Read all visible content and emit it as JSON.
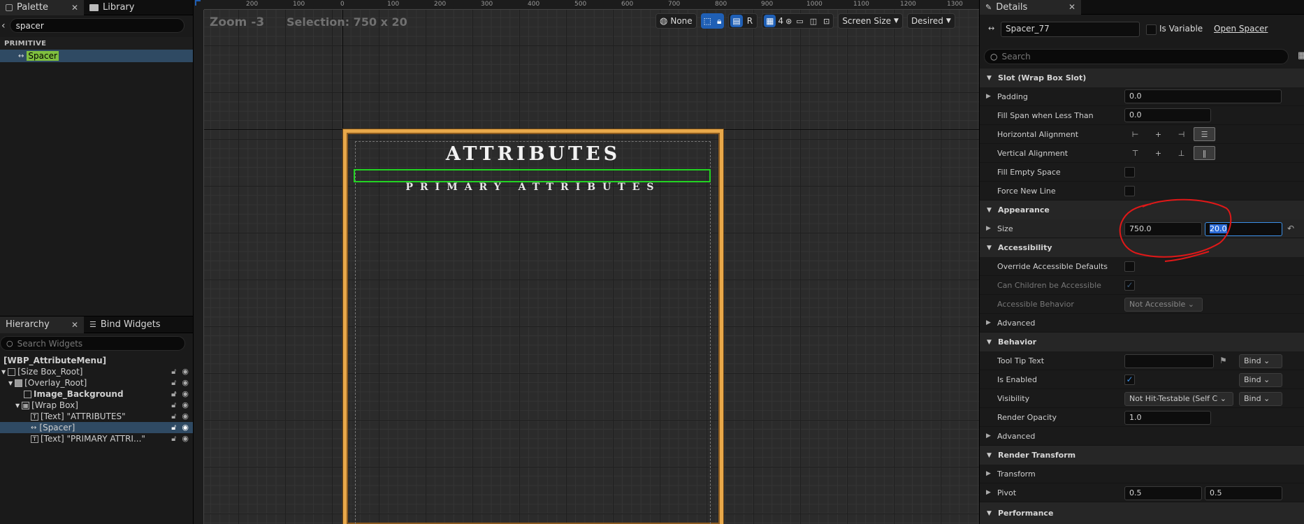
{
  "palette": {
    "tab_label": "Palette",
    "library_label": "Library",
    "search_value": "spacer",
    "category": "PRIMITIVE",
    "item": "Spacer"
  },
  "hierarchy": {
    "tab_label": "Hierarchy",
    "bind_label": "Bind Widgets",
    "search_placeholder": "Search Widgets",
    "root": "[WBP_AttributeMenu]",
    "items": [
      {
        "label": "[Size Box_Root]"
      },
      {
        "label": "[Overlay_Root]"
      },
      {
        "label": "Image_Background"
      },
      {
        "label": "[Wrap Box]"
      },
      {
        "label": "[Text] \"ATTRIBUTES\""
      },
      {
        "label": "[Spacer]"
      },
      {
        "label": "[Text] \"PRIMARY ATTRI...\""
      }
    ]
  },
  "designer": {
    "zoom": "Zoom -3",
    "selection": "Selection: 750 x 20",
    "toolbar": {
      "none": "None",
      "r": "R",
      "grid_num": "4",
      "screen_size": "Screen Size",
      "desired": "Desired"
    },
    "ruler_top": [
      "200",
      "100",
      "0",
      "100",
      "200",
      "300",
      "400",
      "500",
      "600",
      "700",
      "800",
      "900",
      "1000",
      "1100",
      "1200",
      "1300"
    ],
    "widget": {
      "title": "ATTRIBUTES",
      "subtitle": "PRIMARY ATTRIBUTES"
    }
  },
  "details": {
    "tab_label": "Details",
    "name": "Spacer_77",
    "is_variable": "Is Variable",
    "open_link": "Open Spacer",
    "search_placeholder": "Search",
    "slot": "Slot (Wrap Box Slot)",
    "padding": {
      "label": "Padding",
      "value": "0.0"
    },
    "fill_span": {
      "label": "Fill Span when Less Than",
      "value": "0.0"
    },
    "h_align": "Horizontal Alignment",
    "v_align": "Vertical Alignment",
    "fill_empty": "Fill Empty Space",
    "force_new_line": "Force New Line",
    "appearance": "Appearance",
    "size": {
      "label": "Size",
      "x": "750.0",
      "y": "20.0"
    },
    "accessibility": "Accessibility",
    "override_access": "Override Accessible Defaults",
    "children_access": "Can Children be Accessible",
    "access_behavior": {
      "label": "Accessible Behavior",
      "value": "Not Accessible"
    },
    "advanced": "Advanced",
    "behavior": "Behavior",
    "tooltip": {
      "label": "Tool Tip Text",
      "bind": "Bind"
    },
    "is_enabled": {
      "label": "Is Enabled",
      "bind": "Bind"
    },
    "visibility": {
      "label": "Visibility",
      "value": "Not Hit-Testable (Self C",
      "bind": "Bind"
    },
    "render_opacity": {
      "label": "Render Opacity",
      "value": "1.0"
    },
    "advanced2": "Advanced",
    "render_transform": "Render Transform",
    "transform": "Transform",
    "pivot": {
      "label": "Pivot",
      "x": "0.5",
      "y": "0.5"
    },
    "performance": "Performance"
  },
  "colors": {
    "accent": "#1f5fb5",
    "selection_green": "#22d322",
    "frame_gold": "#e8a84a",
    "annotation_red": "#e01818"
  }
}
